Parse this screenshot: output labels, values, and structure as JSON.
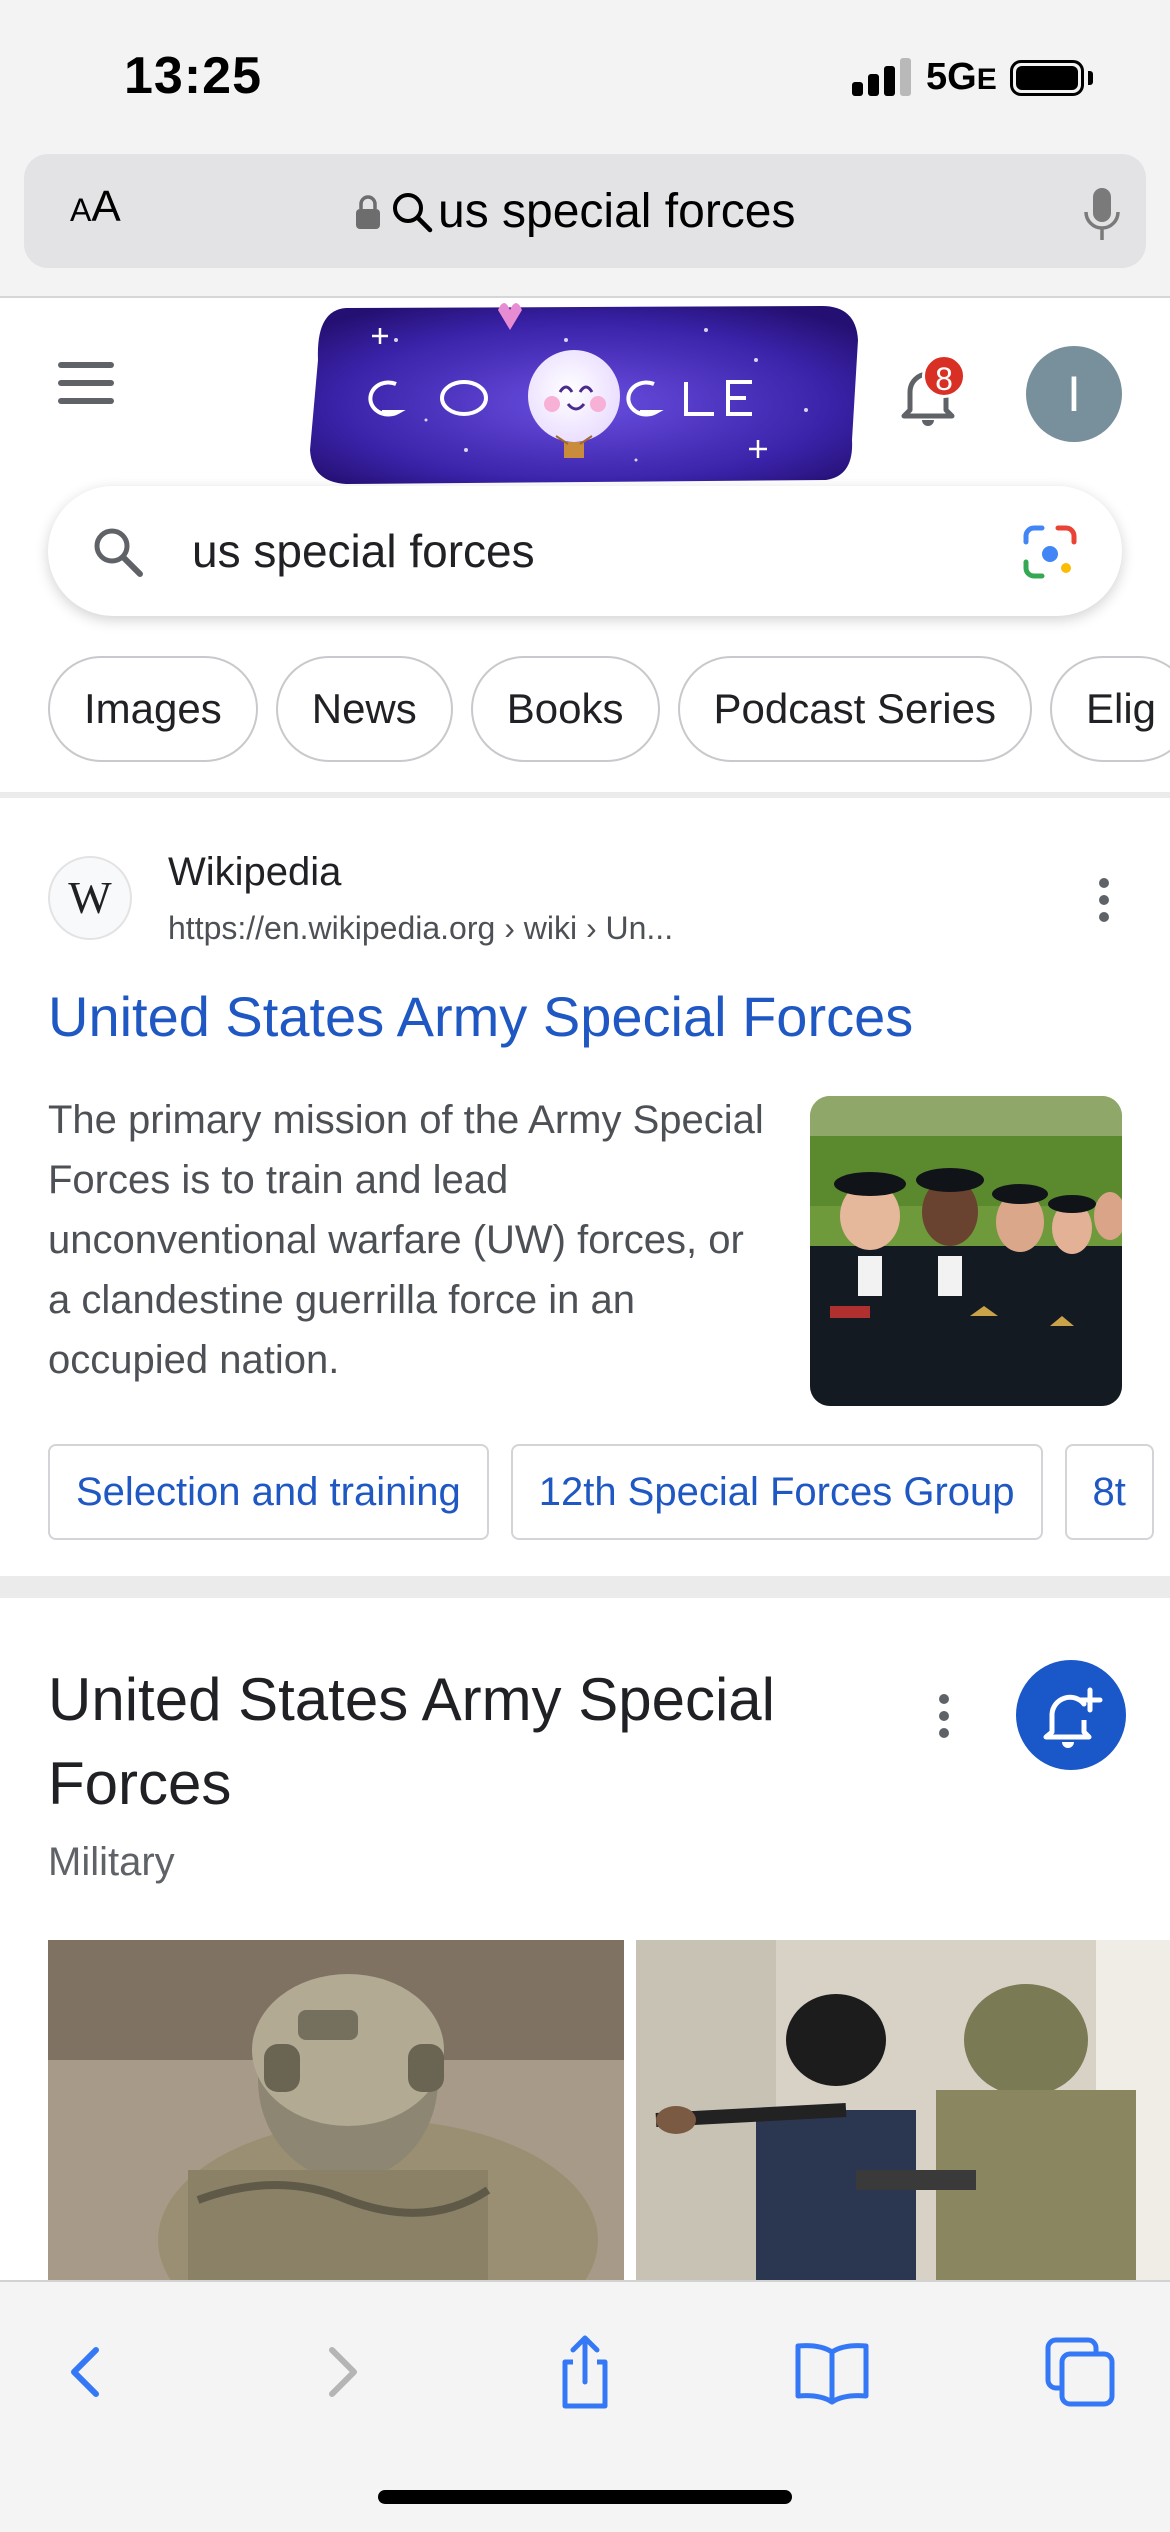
{
  "status_bar": {
    "time": "13:25",
    "network": "5G",
    "network_suffix": "E"
  },
  "safari": {
    "text_size_label": "AA",
    "address_text": "us special forces"
  },
  "google": {
    "doodle_letters": [
      "G",
      "O",
      "G",
      "L",
      "E"
    ],
    "notification_count": "8",
    "avatar_initial": "I",
    "search_query": "us special forces",
    "chips": [
      "Images",
      "News",
      "Books",
      "Podcast Series",
      "Elig"
    ]
  },
  "result": {
    "site_name": "Wikipedia",
    "site_logo": "W",
    "url": "https://en.wikipedia.org › wiki › Un...",
    "title": "United States Army Special Forces",
    "snippet": "The primary mission of the Army Special Forces is to train and lead unconventional warfare (UW) forces, or a clandestine guerrilla force in an occupied nation.",
    "sitelinks": [
      "Selection and training",
      "12th Special Forces Group",
      "8t"
    ]
  },
  "knowledge_panel": {
    "title": "United States Army Special Forces",
    "subtitle": "Military"
  },
  "colors": {
    "link_blue": "#1f57c3",
    "follow_button": "#1a57c9",
    "badge_red": "#d93025",
    "avatar_gray": "#78909c",
    "safari_blue": "#3478f6"
  },
  "icons": {
    "toolbar": [
      "back-icon",
      "forward-icon",
      "share-icon",
      "bookmarks-icon",
      "tabs-icon"
    ]
  }
}
